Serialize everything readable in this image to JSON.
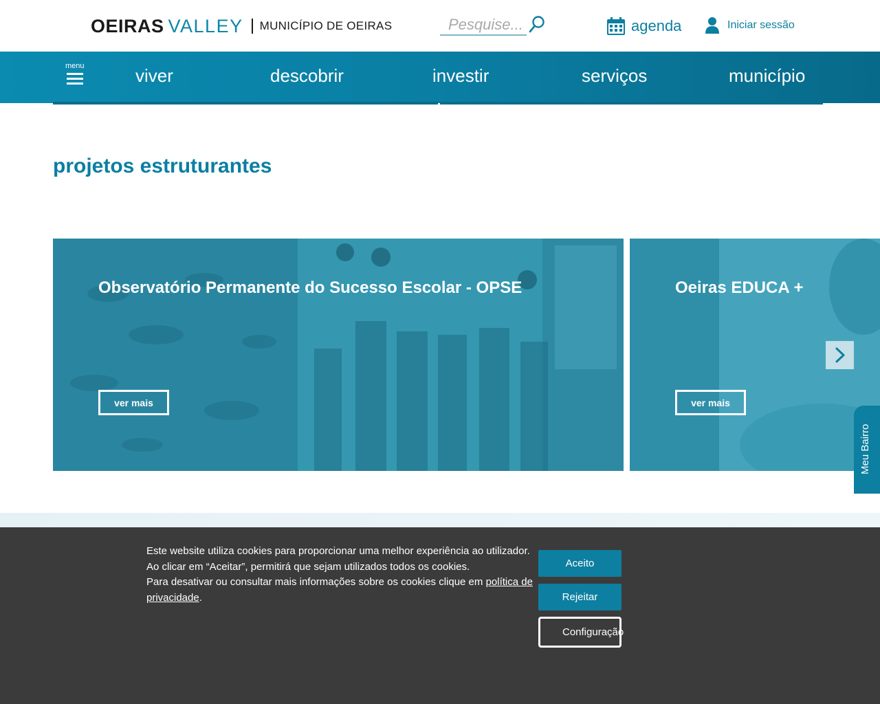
{
  "header": {
    "logo_oeiras": "OEIRAS",
    "logo_valley": "VALLEY",
    "logo_municipio": "MUNICÍPIO DE OEIRAS",
    "search_placeholder": "Pesquise...",
    "agenda_label": "agenda",
    "login_label": "Iniciar sessão"
  },
  "nav": {
    "menu_label": "menu",
    "items": [
      {
        "label": "viver"
      },
      {
        "label": "descobrir"
      },
      {
        "label": "investir"
      },
      {
        "label": "serviços"
      },
      {
        "label": "município"
      }
    ]
  },
  "section": {
    "title": "projetos estruturantes",
    "cards": [
      {
        "title": "Observatório Permanente do Sucesso Escolar - OPSE",
        "button": "ver mais"
      },
      {
        "title": "Oeiras EDUCA +",
        "button": "ver mais"
      }
    ]
  },
  "side_tab": {
    "label": "Meu Bairro"
  },
  "cookie": {
    "line1": "Este website utiliza cookies para proporcionar uma melhor experiência ao utilizador.",
    "line2": "Ao clicar em “Aceitar”, permitirá que sejam utilizados todos os cookies.",
    "line3": "Para desativar ou consultar mais informações sobre os cookies clique em ",
    "link": "política de privacidade",
    "end": ".",
    "accept": "Aceito",
    "reject": "Rejeitar",
    "config": "Configuração"
  },
  "colors": {
    "brand": "#0d7fa0",
    "nav_gradient_start": "#0b8bb0",
    "nav_gradient_end": "#086a8a",
    "cookie_bg": "#3b3b3b"
  }
}
